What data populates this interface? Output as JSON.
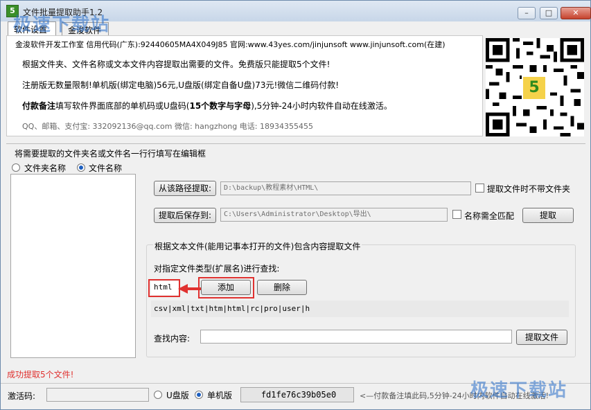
{
  "window": {
    "title": "文件批量提取助手1.2",
    "minimize_glyph": "–",
    "maximize_glyph": "□",
    "close_glyph": "✕"
  },
  "tabs": [
    "软件设置",
    "金浚软件"
  ],
  "info": {
    "line1": "金浚软件开发工作室 信用代码(广东):92440605MA4X049J85 官网:www.43yes.com/jinjunsoft  www.jinjunsoft.com(在建)",
    "line2": "根据文件夹、文件名称或文本文件内容提取出需要的文件。免费版只能提取5个文件!",
    "line3": "注册版无数量限制!单机版(绑定电脑)56元,U盘版(绑定自备U盘)73元!微信二维码付款!",
    "line4_bold": "付款备注",
    "line4_rest": "填写软件界面底部的单机码或U盘码(",
    "line4_bold2": "15个数字与字母",
    "line4_end": "),5分钟-24小时内软件自动在线激活。",
    "line5": "QQ、邮箱、支付宝: 332092136@qq.com  微信: hangzhong  电话: 18934355455"
  },
  "section": {
    "title": "将需要提取的文件夹名或文件名一行行填写在编辑框",
    "radio_folder": "文件夹名称",
    "radio_file": "文件名称",
    "selected": "文件名称"
  },
  "path": {
    "from_button": "从该路径提取:",
    "from_value": "D:\\backup\\教程素材\\HTML\\",
    "no_folder_check": "提取文件时不带文件夹",
    "save_button": "提取后保存到:",
    "save_value": "C:\\Users\\Administrator\\Desktop\\导出\\",
    "exact_match_check": "名称需全匹配",
    "extract_button": "提取"
  },
  "content_group": {
    "title": "根据文本文件(能用记事本打开的文件)包含内容提取文件",
    "ext_label": "对指定文件类型(扩展名)进行查找:",
    "ext_input": "html",
    "add_button": "添加",
    "delete_button": "删除",
    "ext_list": "csv|xml|txt|htm|html|rc|pro|user|h",
    "search_label": "查找内容:",
    "search_value": "",
    "extract_file_button": "提取文件"
  },
  "status": "成功提取5个文件!",
  "footer": {
    "activation_label": "激活码:",
    "activation_value": "",
    "usb_radio": "U盘版",
    "standalone_radio": "单机版",
    "machine_code": "fd1fe76c39b05e0",
    "hint": "<—付款备注填此码,5分钟-24小时内软件自动在线激活!"
  },
  "watermark": {
    "top": "极速下载站",
    "bottom": "极速下载站"
  },
  "colors": {
    "accent_red": "#e0312f",
    "radio_selected": "#1d5fbf"
  }
}
